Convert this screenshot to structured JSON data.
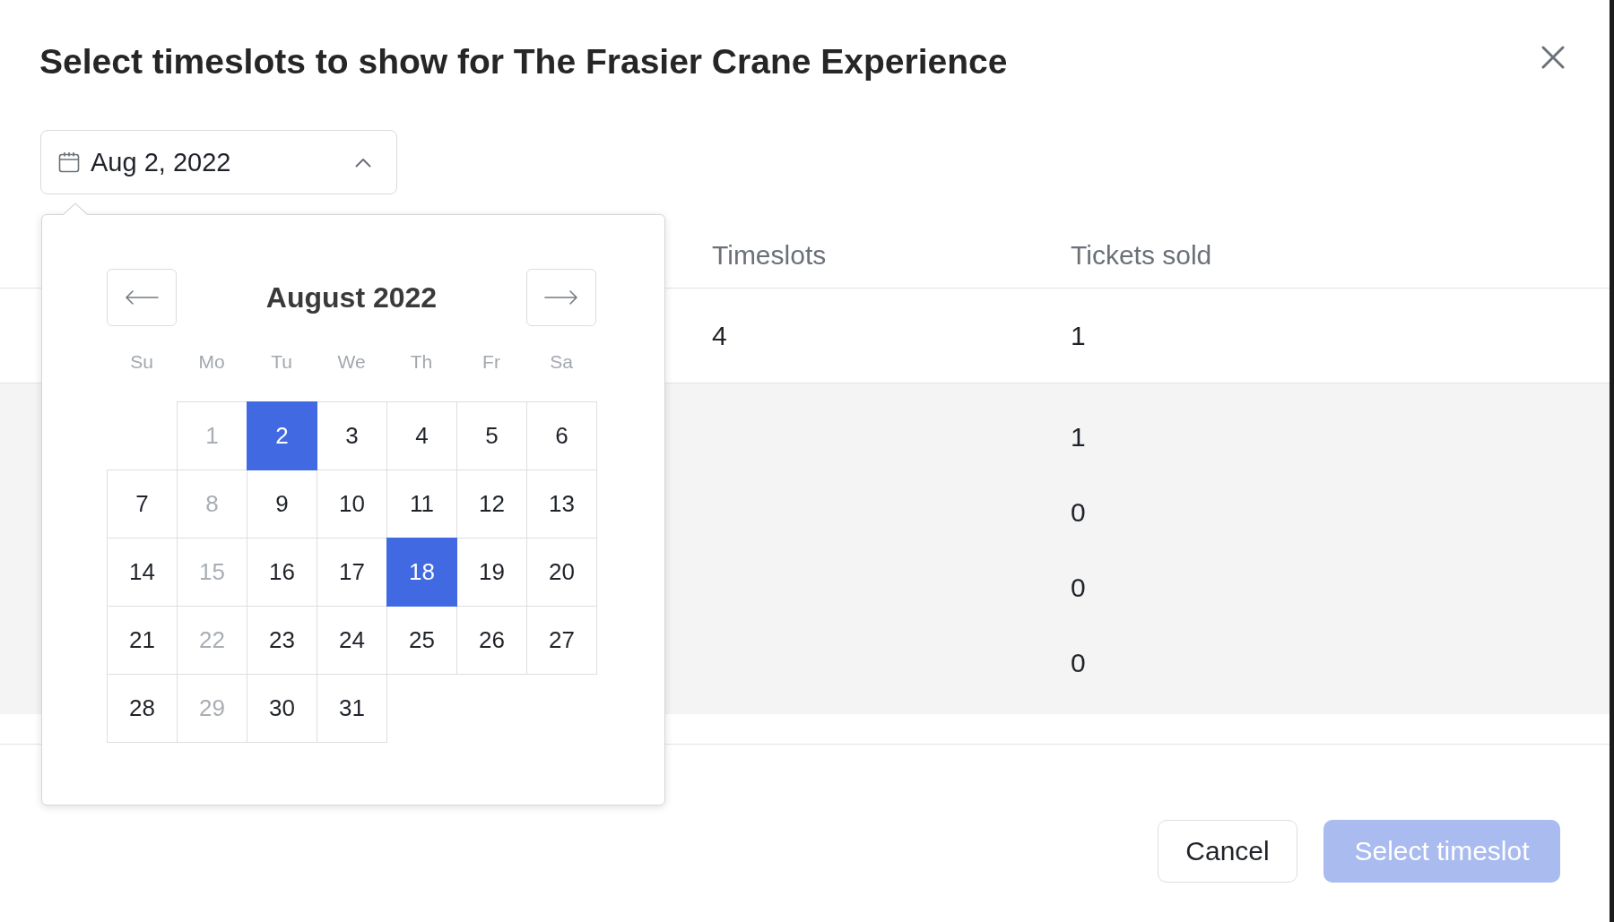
{
  "dialog": {
    "title": "Select timeslots to show for The Frasier Crane Experience"
  },
  "date_picker": {
    "value": "Aug 2, 2022",
    "expanded": true,
    "calendar": {
      "month": "August 2022",
      "weekdays": [
        "Su",
        "Mo",
        "Tu",
        "We",
        "Th",
        "Fr",
        "Sa"
      ],
      "weeks": [
        {
          "days": [
            {
              "label": "1",
              "disabled": true,
              "selected": false
            },
            {
              "label": "2",
              "disabled": false,
              "selected": true
            },
            {
              "label": "3",
              "disabled": false,
              "selected": false
            },
            {
              "label": "4",
              "disabled": false,
              "selected": false
            },
            {
              "label": "5",
              "disabled": false,
              "selected": false
            },
            {
              "label": "6",
              "disabled": false,
              "selected": false
            }
          ]
        },
        {
          "days": [
            {
              "label": "7",
              "disabled": false,
              "selected": false
            },
            {
              "label": "8",
              "disabled": true,
              "selected": false
            },
            {
              "label": "9",
              "disabled": false,
              "selected": false
            },
            {
              "label": "10",
              "disabled": false,
              "selected": false
            },
            {
              "label": "11",
              "disabled": false,
              "selected": false
            },
            {
              "label": "12",
              "disabled": false,
              "selected": false
            },
            {
              "label": "13",
              "disabled": false,
              "selected": false
            }
          ]
        },
        {
          "days": [
            {
              "label": "14",
              "disabled": false,
              "selected": false
            },
            {
              "label": "15",
              "disabled": true,
              "selected": false
            },
            {
              "label": "16",
              "disabled": false,
              "selected": false
            },
            {
              "label": "17",
              "disabled": false,
              "selected": false
            },
            {
              "label": "18",
              "disabled": false,
              "selected": true
            },
            {
              "label": "19",
              "disabled": false,
              "selected": false
            },
            {
              "label": "20",
              "disabled": false,
              "selected": false
            }
          ]
        },
        {
          "days": [
            {
              "label": "21",
              "disabled": false,
              "selected": false
            },
            {
              "label": "22",
              "disabled": true,
              "selected": false
            },
            {
              "label": "23",
              "disabled": false,
              "selected": false
            },
            {
              "label": "24",
              "disabled": false,
              "selected": false
            },
            {
              "label": "25",
              "disabled": false,
              "selected": false
            },
            {
              "label": "26",
              "disabled": false,
              "selected": false
            },
            {
              "label": "27",
              "disabled": false,
              "selected": false
            }
          ]
        },
        {
          "days": [
            {
              "label": "28",
              "disabled": false,
              "selected": false
            },
            {
              "label": "29",
              "disabled": true,
              "selected": false
            },
            {
              "label": "30",
              "disabled": false,
              "selected": false
            },
            {
              "label": "31",
              "disabled": false,
              "selected": false
            }
          ]
        }
      ]
    }
  },
  "table": {
    "columns": [
      "Timeslots",
      "Tickets sold"
    ],
    "rows": [
      {
        "cells": [
          "4",
          "1"
        ],
        "sub_rows": [
          {
            "tickets_sold": "1"
          },
          {
            "tickets_sold": "0"
          },
          {
            "tickets_sold": "0"
          },
          {
            "tickets_sold": "0"
          }
        ]
      }
    ]
  },
  "footer": {
    "buttons": [
      {
        "label": "Cancel",
        "kind": "secondary",
        "disabled": false
      },
      {
        "label": "Select timeslot",
        "kind": "primary",
        "disabled": true
      }
    ]
  }
}
